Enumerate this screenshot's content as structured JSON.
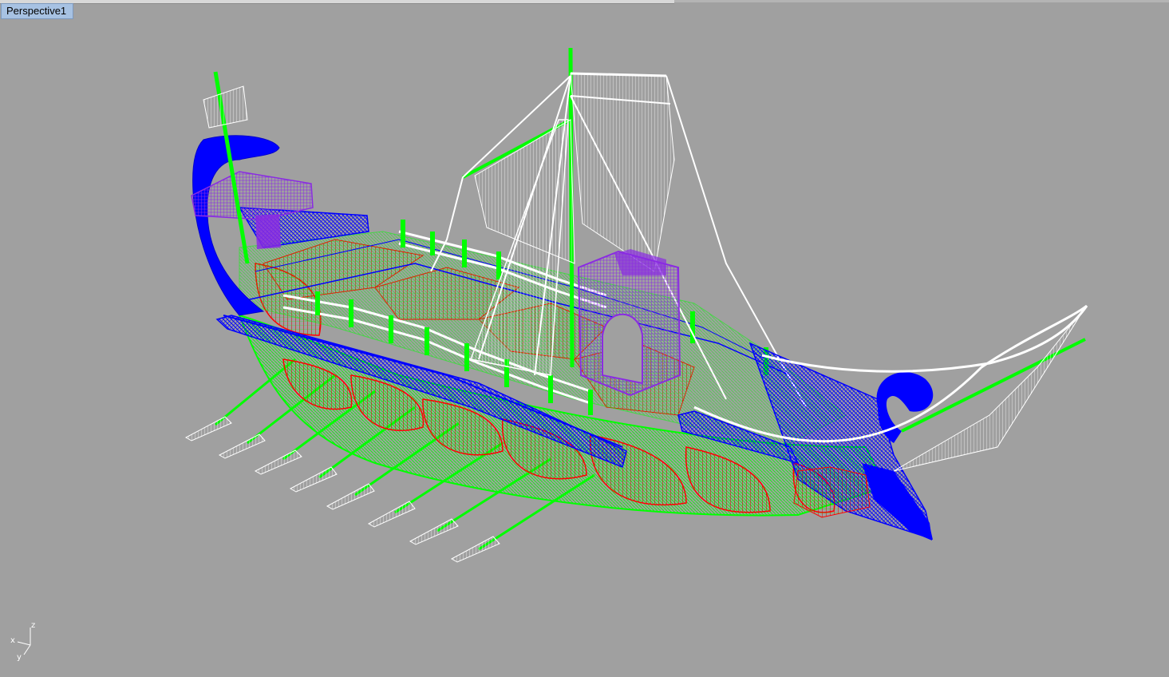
{
  "viewport": {
    "title": "Perspective1",
    "background": "#a0a0a0",
    "display_mode": "wireframe"
  },
  "model": {
    "layer_colors": {
      "hull_planks": "#ff0000",
      "hull_frames_oars_masts": "#00ff00",
      "prow_stern_rails": "#0000ff",
      "sails_rigging": "#ffffff",
      "towers_canopy": "#8a2be2"
    }
  },
  "axis": {
    "x": "x",
    "y": "y",
    "z": "z"
  }
}
